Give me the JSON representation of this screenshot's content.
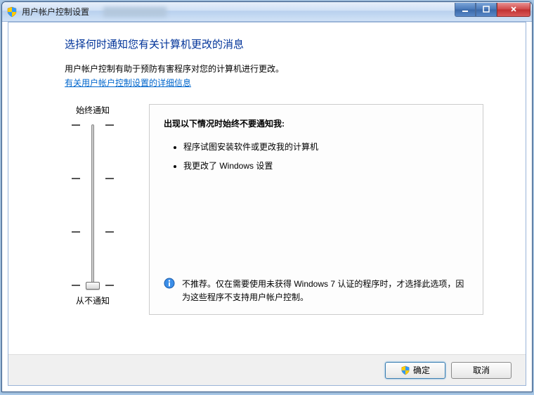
{
  "window": {
    "title": "用户帐户控制设置"
  },
  "main": {
    "heading": "选择何时通知您有关计算机更改的消息",
    "subtext": "用户帐户控制有助于预防有害程序对您的计算机进行更改。",
    "link": "有关用户帐户控制设置的详细信息"
  },
  "slider": {
    "top_label": "始终通知",
    "bottom_label": "从不通知",
    "levels": 4,
    "value": 0
  },
  "detail": {
    "title": "出现以下情况时始终不要通知我:",
    "bullets": [
      "程序试图安装软件或更改我的计算机",
      "我更改了 Windows 设置"
    ],
    "recommend": "不推荐。仅在需要使用未获得 Windows 7 认证的程序时，才选择此选项，因为这些程序不支持用户帐户控制。"
  },
  "buttons": {
    "ok": "确定",
    "cancel": "取消"
  }
}
